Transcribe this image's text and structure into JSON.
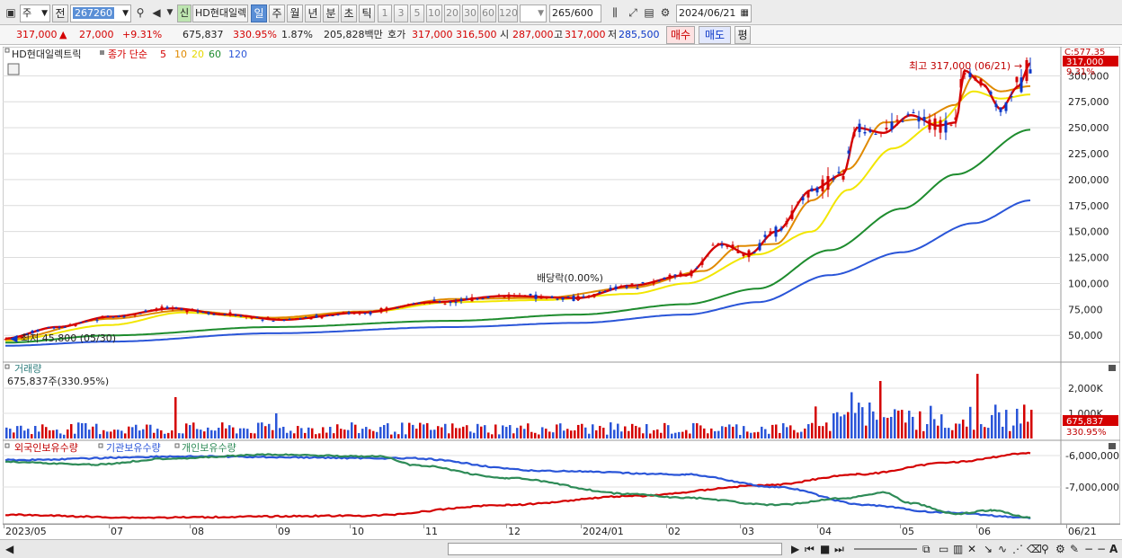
{
  "toolbar": {
    "period_type": "주",
    "prefix_btn": "전",
    "code": "267260",
    "new_badge": "신",
    "name": "HD현대일렉",
    "intervals": [
      "일",
      "주",
      "월",
      "년",
      "분",
      "초",
      "틱"
    ],
    "active_interval": "일",
    "numbers": [
      "1",
      "3",
      "5",
      "10",
      "20",
      "30",
      "60",
      "120"
    ],
    "count": "265",
    "total": "/600",
    "date": "2024/06/21"
  },
  "quote": {
    "price": "317,000",
    "change": "27,000",
    "rate": "+9.31%",
    "volume": "675,837",
    "vol_rate": "330.95%",
    "turnover": "1.87%",
    "amount": "205,828백만",
    "ask_label": "호가",
    "ask1": "317,000",
    "ask2": "316,500",
    "open_label": "시",
    "open": "287,000",
    "high_label": "고",
    "high": "317,000",
    "low_label": "저",
    "low": "285,500",
    "buy": "매수",
    "sell": "매도",
    "eval": "평"
  },
  "price_chart": {
    "legend_name": "HD현대일렉트릭",
    "legend_ma": "종가 단순",
    "ma_periods": [
      "5",
      "10",
      "20",
      "60",
      "120"
    ],
    "ma_colors": [
      "#d40000",
      "#e08a00",
      "#f2e600",
      "#1e8c2e",
      "#2a55d8"
    ],
    "high_note": "최고 317,000 (06/21)",
    "low_note": "최저 45,800 (05/30)",
    "dividend_note": "배당락(0.00%)",
    "last_price_tag": "317,000",
    "last_rate_tag": "9.31%",
    "top_tag": "C:577.35",
    "y_ticks": [
      "300,000",
      "275,000",
      "250,000",
      "225,000",
      "200,000",
      "175,000",
      "150,000",
      "125,000",
      "100,000",
      "75,000",
      "50,000"
    ]
  },
  "volume_chart": {
    "title": "거래량",
    "value": "675,837주(330.95%)",
    "y_ticks": [
      "2,000K",
      "1,000K"
    ],
    "last_tag": "675,837",
    "last_rate": "330.95%"
  },
  "holding_chart": {
    "series_labels": [
      "외국인보유수량",
      "기관보유수량",
      "개인보유수량"
    ],
    "series_colors": [
      "#d40000",
      "#2a55d8",
      "#2e8b57"
    ],
    "y_ticks": [
      "-6,000,000",
      "-7,000,000"
    ]
  },
  "x_axis": [
    "2023/05",
    "07",
    "08",
    "09",
    "10",
    "11",
    "12",
    "2024/01",
    "02",
    "03",
    "04",
    "05",
    "06",
    "06/21"
  ]
}
